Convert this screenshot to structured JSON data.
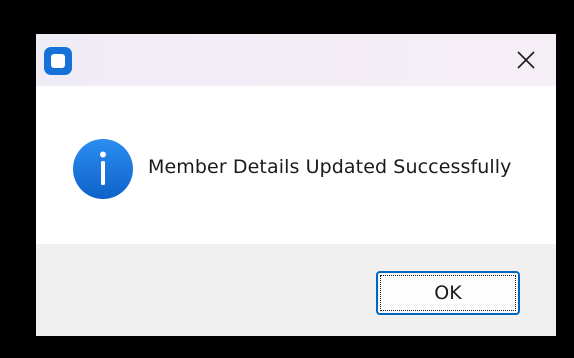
{
  "dialog": {
    "message": "Member Details Updated Successfully",
    "ok_label": "OK",
    "icon": "info-icon",
    "close_icon": "close-icon",
    "app_icon": "app-icon"
  },
  "colors": {
    "accent": "#1672d9",
    "info_icon": "#1877e0",
    "button_border": "#0067c0",
    "footer_bg": "#f0f0f0",
    "titlebar_bg": "#f3eef6"
  }
}
